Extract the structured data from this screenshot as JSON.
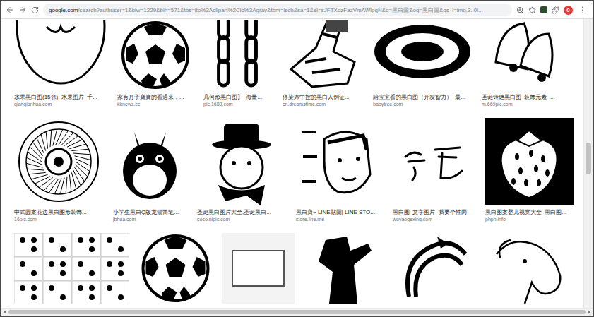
{
  "browser": {
    "url_host": "google.com",
    "url_path": "/search?authuser=1&biw=1229&bih=571&tbs=itp%3Aclipart%2Cic%3Agray&tbm=isch&sa=1&ei=sJFTXdzFazVmAWlpqN&q=黑白圖&oq=黑白圖&gs_l=img.3..0l...",
    "badge": "0",
    "menu": "⋮"
  },
  "rows": [
    {
      "items": [
        {
          "caption": "水果黑白图(15张)_水果图片_千...",
          "source": "qianqianhua.com"
        },
        {
          "caption": "家有月子寶寶的看過來，...",
          "source": "kknews.cc"
        },
        {
          "caption": "几何形黑白图】_海量...",
          "source": "pic.1688.com"
        },
        {
          "caption": "停染席中控的黑白人例证...",
          "source": "cn.dreamstime.com"
        },
        {
          "caption": "給宝宝看的黑白图（开发智力）_最...",
          "source": "babytree.com"
        },
        {
          "caption": "圣诞铃铛黑白图_装饰元素_...",
          "source": "m.669pic.com"
        }
      ]
    },
    {
      "items": [
        {
          "caption": "中式圆案花边黑白图形装饰...",
          "source": "16pic.com"
        },
        {
          "caption": "小学生黑白Q版龙猫简笔...",
          "source": "jbhua.com"
        },
        {
          "caption": "圣诞黑白图片大全,圣诞黑白...",
          "source": "soso.nipic.com"
        },
        {
          "caption": "黑白寶~ LINE貼圖| LINE STO...",
          "source": "store.line.me"
        },
        {
          "caption": "黑白图_文字图片_我要个性网",
          "source": "woyaogexing.com"
        },
        {
          "caption": "黑白图案婴儿视觉大全_黑白图...",
          "source": "phph.info"
        }
      ]
    },
    {
      "items": [
        {},
        {},
        {},
        {},
        {},
        {}
      ]
    }
  ],
  "vertical_scrollbar": {
    "level": 0.48
  }
}
